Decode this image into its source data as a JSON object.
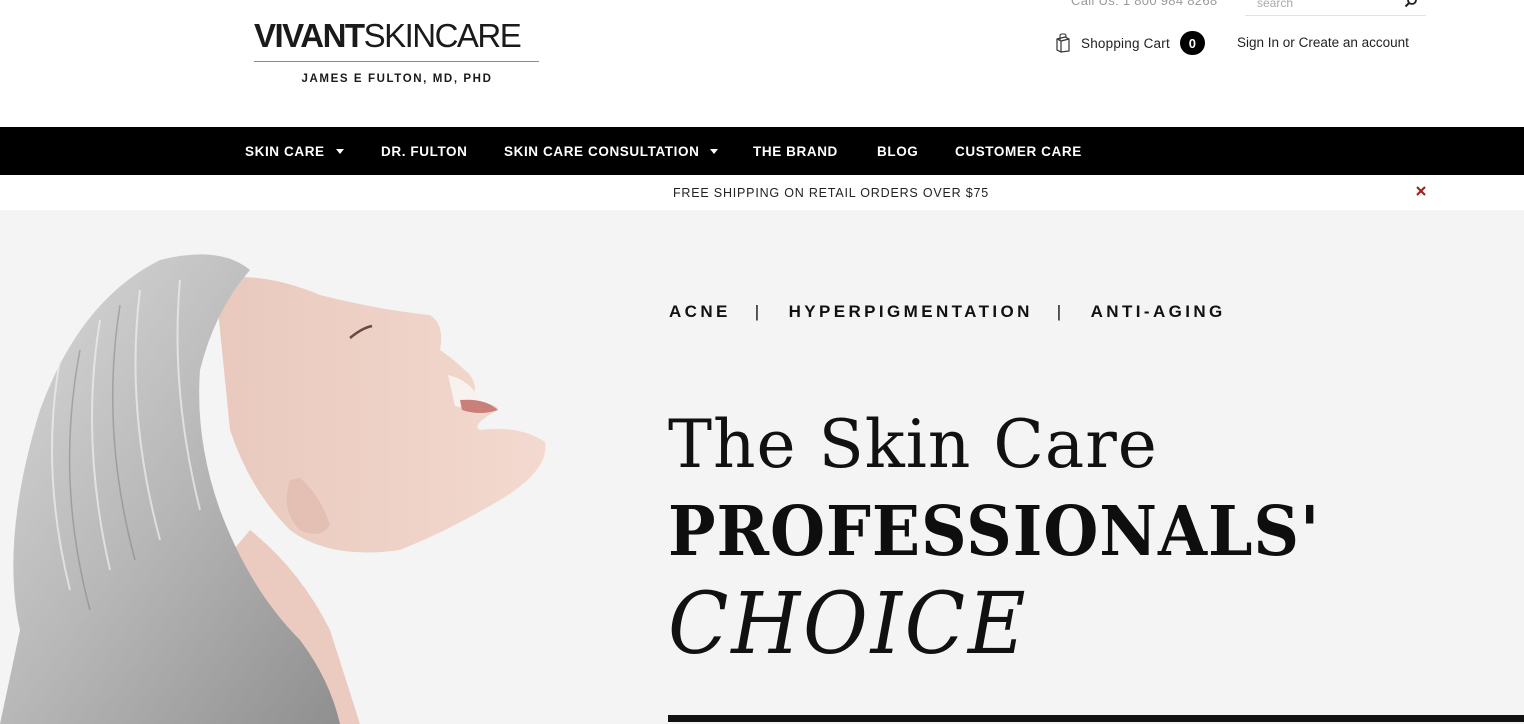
{
  "header": {
    "logo": {
      "bold": "VIVANT",
      "light": "SKINCARE",
      "subtitle": "JAMES E FULTON, MD, PHD"
    },
    "call_us": "Call Us: 1 800 984 8268",
    "search": {
      "placeholder": "search",
      "icon": "search-icon"
    },
    "cart": {
      "label": "Shopping Cart",
      "count": "0",
      "icon": "shopping-bag-icon"
    },
    "account": {
      "sign_in": "Sign In",
      "separator": "or",
      "create": "Create an account"
    }
  },
  "nav": {
    "items": [
      {
        "label": "SKIN CARE",
        "has_dropdown": true
      },
      {
        "label": "DR. FULTON",
        "has_dropdown": false
      },
      {
        "label": "SKIN CARE CONSULTATION",
        "has_dropdown": true
      },
      {
        "label": "THE BRAND",
        "has_dropdown": false
      },
      {
        "label": "BLOG",
        "has_dropdown": false
      },
      {
        "label": "CUSTOMER CARE",
        "has_dropdown": false
      }
    ]
  },
  "promo": {
    "text": "FREE SHIPPING ON RETAIL ORDERS OVER $75",
    "close_icon": "close-icon",
    "close_color": "#a31c1c"
  },
  "hero": {
    "tags": [
      "ACNE",
      "HYPERPIGMENTATION",
      "ANTI-AGING"
    ],
    "tag_separator": "|",
    "headline_line1": "The Skin Care",
    "headline_line2": "PROFESSIONALS'",
    "headline_line3": "CHOICE"
  },
  "colors": {
    "nav_background": "#000000",
    "hero_background": "#f4f4f4",
    "text": "#111111"
  }
}
